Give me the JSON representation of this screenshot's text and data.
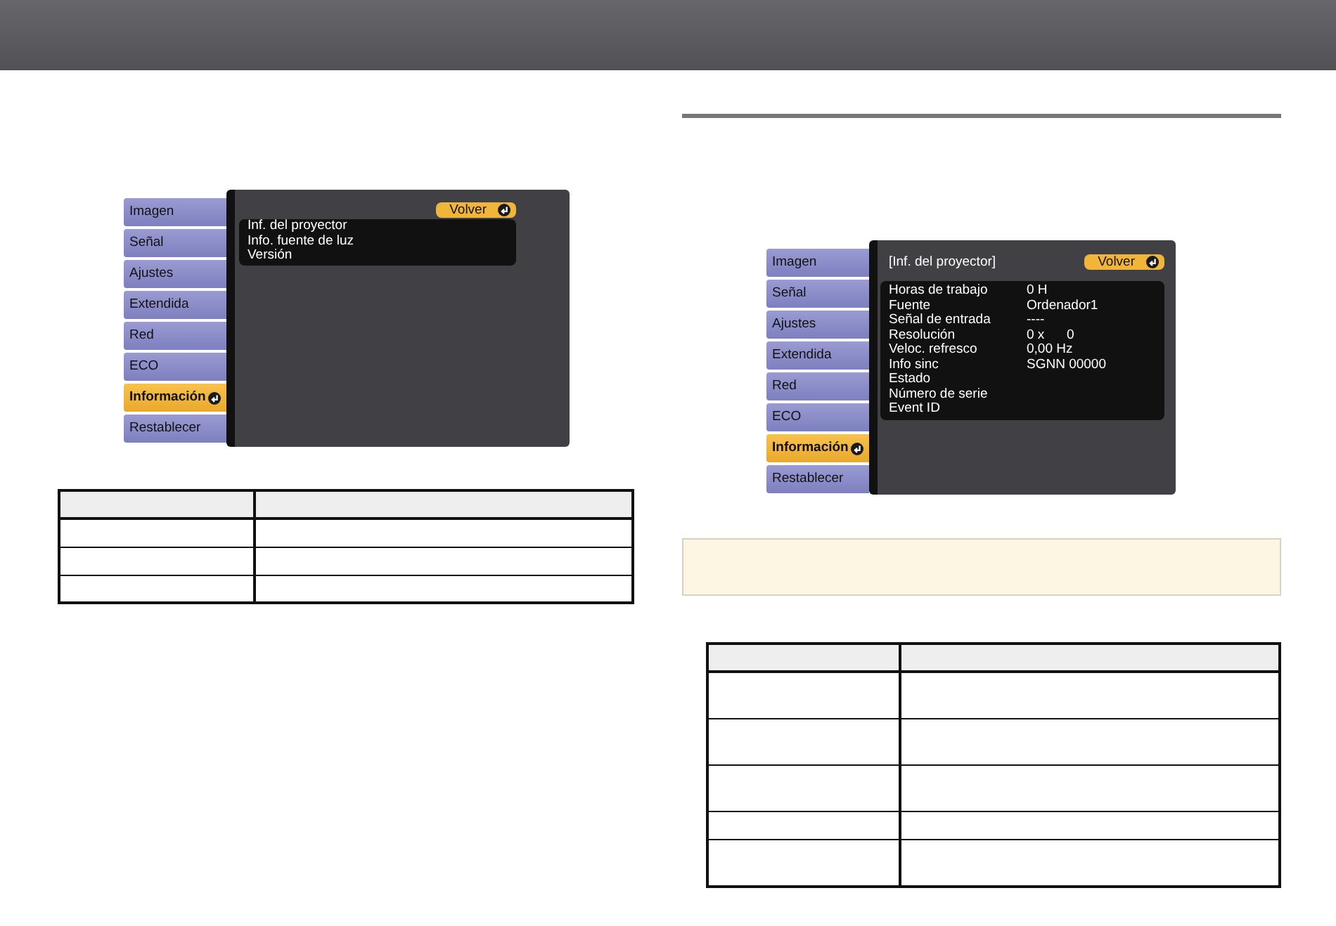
{
  "menus": [
    {
      "tabs": [
        {
          "label": "Imagen",
          "selected": false
        },
        {
          "label": "Señal",
          "selected": false
        },
        {
          "label": "Ajustes",
          "selected": false
        },
        {
          "label": "Extendida",
          "selected": false
        },
        {
          "label": "Red",
          "selected": false
        },
        {
          "label": "ECO",
          "selected": false
        },
        {
          "label": "Información",
          "selected": true
        },
        {
          "label": "Restablecer",
          "selected": false
        }
      ],
      "back_button": "Volver",
      "items": [
        "Inf. del proyector",
        "Info. fuente de luz",
        "Versión"
      ]
    },
    {
      "tabs": [
        {
          "label": "Imagen",
          "selected": false
        },
        {
          "label": "Señal",
          "selected": false
        },
        {
          "label": "Ajustes",
          "selected": false
        },
        {
          "label": "Extendida",
          "selected": false
        },
        {
          "label": "Red",
          "selected": false
        },
        {
          "label": "ECO",
          "selected": false
        },
        {
          "label": "Información",
          "selected": true
        },
        {
          "label": "Restablecer",
          "selected": false
        }
      ],
      "title": "[Inf. del proyector]",
      "back_button": "Volver",
      "info_rows": [
        {
          "label": "Horas de trabajo",
          "value": "0 H"
        },
        {
          "label": "Fuente",
          "value": "Ordenador1"
        },
        {
          "label": "Señal de entrada",
          "value": "----"
        },
        {
          "label": "Resolución",
          "value": "0 x      0"
        },
        {
          "label": "Veloc. refresco",
          "value": "0,00 Hz"
        },
        {
          "label": "Info sinc",
          "value": "SGNN 00000"
        },
        {
          "label": "Estado"
        },
        {
          "label": "Número de serie"
        },
        {
          "label": "Event ID"
        }
      ]
    }
  ]
}
